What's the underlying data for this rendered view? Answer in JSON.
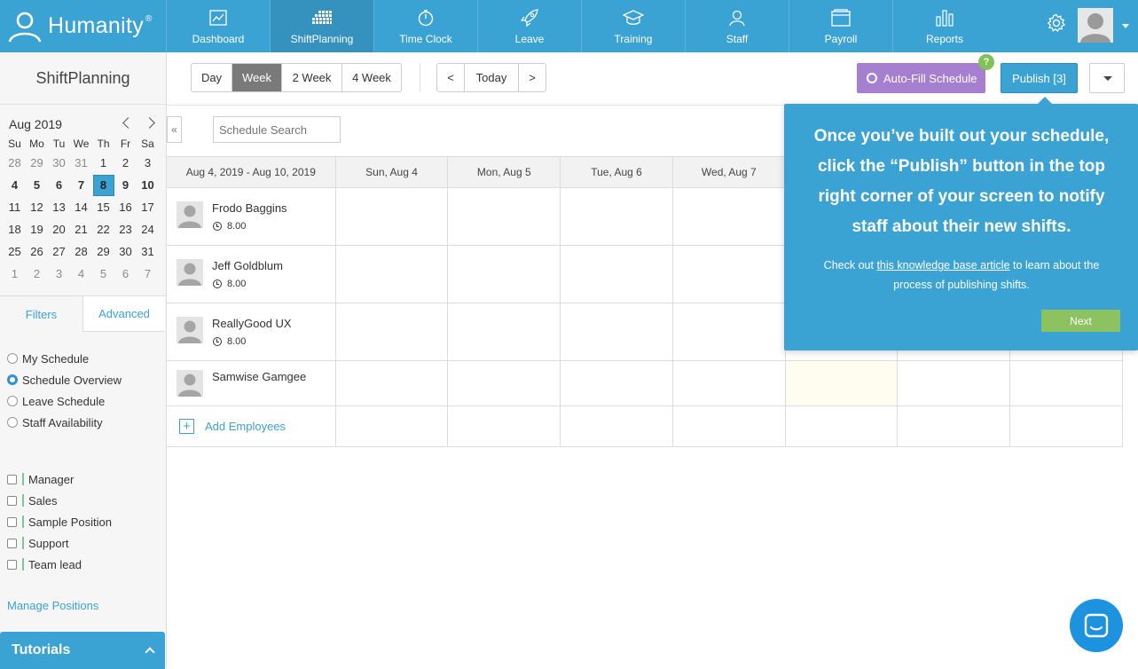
{
  "app": {
    "brand": "Humanity",
    "reg": "®"
  },
  "nav": [
    {
      "label": "Dashboard",
      "icon": "dashboard-icon",
      "active": false
    },
    {
      "label": "ShiftPlanning",
      "icon": "shiftplanning-icon",
      "active": true
    },
    {
      "label": "Time Clock",
      "icon": "stopwatch-icon",
      "active": false
    },
    {
      "label": "Leave",
      "icon": "rocket-icon",
      "active": false
    },
    {
      "label": "Training",
      "icon": "graduation-cap-icon",
      "active": false
    },
    {
      "label": "Staff",
      "icon": "person-icon",
      "active": false
    },
    {
      "label": "Payroll",
      "icon": "wallet-icon",
      "active": false
    },
    {
      "label": "Reports",
      "icon": "bar-chart-icon",
      "active": false
    }
  ],
  "sidebar": {
    "title": "ShiftPlanning",
    "calendar": {
      "month": "Aug 2019",
      "dow": [
        "Su",
        "Mo",
        "Tu",
        "We",
        "Th",
        "Fr",
        "Sa"
      ],
      "weeks": [
        [
          "28",
          "29",
          "30",
          "31",
          "1",
          "2",
          "3"
        ],
        [
          "4",
          "5",
          "6",
          "7",
          "8",
          "9",
          "10"
        ],
        [
          "11",
          "12",
          "13",
          "14",
          "15",
          "16",
          "17"
        ],
        [
          "18",
          "19",
          "20",
          "21",
          "22",
          "23",
          "24"
        ],
        [
          "25",
          "26",
          "27",
          "28",
          "29",
          "30",
          "31"
        ],
        [
          "1",
          "2",
          "3",
          "4",
          "5",
          "6",
          "7"
        ]
      ],
      "selected": "8"
    },
    "tabs": {
      "filters": "Filters",
      "advanced": "Advanced"
    },
    "views": [
      {
        "label": "My Schedule",
        "checked": false
      },
      {
        "label": "Schedule Overview",
        "checked": true
      },
      {
        "label": "Leave Schedule",
        "checked": false
      },
      {
        "label": "Staff Availability",
        "checked": false
      }
    ],
    "positions": [
      "Manager",
      "Sales",
      "Sample Position",
      "Support",
      "Team lead"
    ],
    "manage_positions": "Manage Positions",
    "tutorials": "Tutorials"
  },
  "toolbar": {
    "views": [
      "Day",
      "Week",
      "2 Week",
      "4 Week"
    ],
    "active_view": "Week",
    "prev": "<",
    "today": "Today",
    "next": ">",
    "autofill": "Auto-Fill Schedule",
    "help_badge": "?",
    "publish": "Publish [3]"
  },
  "search": {
    "placeholder": "Schedule Search",
    "collapse": "«"
  },
  "schedule": {
    "range": "Aug 4, 2019 - Aug 10, 2019",
    "days": [
      "Sun, Aug 4",
      "Mon, Aug 5",
      "Tue, Aug 6",
      "Wed, Aug 7",
      "",
      "",
      ""
    ],
    "employees": [
      {
        "name": "Frodo Baggins",
        "hours": "8.00"
      },
      {
        "name": "Jeff Goldblum",
        "hours": "8.00"
      },
      {
        "name": "ReallyGood UX",
        "hours": "8.00"
      },
      {
        "name": "Samwise Gamgee",
        "hours": ""
      }
    ],
    "add_employees": "Add Employees"
  },
  "popover": {
    "headline": "Once you’ve built out your schedule, click the “Publish” button in the top right corner of your screen to notify staff about their new shifts.",
    "body_pre": "Check out ",
    "body_link": "this knowledge base article",
    "body_post": " to learn about the process of publishing shifts.",
    "next": "Next"
  },
  "colors": {
    "brand_blue": "#3ba2d4",
    "autofill_purple": "#a77fd1",
    "next_green": "#8cc25f",
    "chat_blue": "#1d93e0"
  }
}
